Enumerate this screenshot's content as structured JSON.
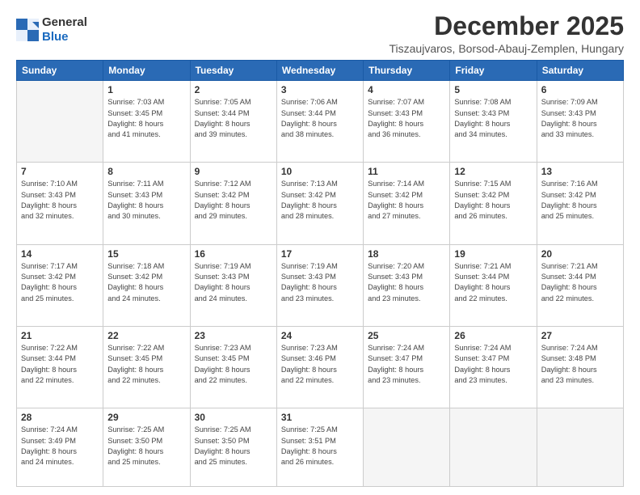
{
  "logo": {
    "general": "General",
    "blue": "Blue"
  },
  "title": "December 2025",
  "location": "Tiszaujvaros, Borsod-Abauj-Zemplen, Hungary",
  "weekdays": [
    "Sunday",
    "Monday",
    "Tuesday",
    "Wednesday",
    "Thursday",
    "Friday",
    "Saturday"
  ],
  "weeks": [
    [
      {
        "day": null,
        "sunrise": null,
        "sunset": null,
        "daylight": null
      },
      {
        "day": "1",
        "sunrise": "7:03 AM",
        "sunset": "3:45 PM",
        "daylight": "8 hours and 41 minutes."
      },
      {
        "day": "2",
        "sunrise": "7:05 AM",
        "sunset": "3:44 PM",
        "daylight": "8 hours and 39 minutes."
      },
      {
        "day": "3",
        "sunrise": "7:06 AM",
        "sunset": "3:44 PM",
        "daylight": "8 hours and 38 minutes."
      },
      {
        "day": "4",
        "sunrise": "7:07 AM",
        "sunset": "3:43 PM",
        "daylight": "8 hours and 36 minutes."
      },
      {
        "day": "5",
        "sunrise": "7:08 AM",
        "sunset": "3:43 PM",
        "daylight": "8 hours and 34 minutes."
      },
      {
        "day": "6",
        "sunrise": "7:09 AM",
        "sunset": "3:43 PM",
        "daylight": "8 hours and 33 minutes."
      }
    ],
    [
      {
        "day": "7",
        "sunrise": "7:10 AM",
        "sunset": "3:43 PM",
        "daylight": "8 hours and 32 minutes."
      },
      {
        "day": "8",
        "sunrise": "7:11 AM",
        "sunset": "3:43 PM",
        "daylight": "8 hours and 30 minutes."
      },
      {
        "day": "9",
        "sunrise": "7:12 AM",
        "sunset": "3:42 PM",
        "daylight": "8 hours and 29 minutes."
      },
      {
        "day": "10",
        "sunrise": "7:13 AM",
        "sunset": "3:42 PM",
        "daylight": "8 hours and 28 minutes."
      },
      {
        "day": "11",
        "sunrise": "7:14 AM",
        "sunset": "3:42 PM",
        "daylight": "8 hours and 27 minutes."
      },
      {
        "day": "12",
        "sunrise": "7:15 AM",
        "sunset": "3:42 PM",
        "daylight": "8 hours and 26 minutes."
      },
      {
        "day": "13",
        "sunrise": "7:16 AM",
        "sunset": "3:42 PM",
        "daylight": "8 hours and 25 minutes."
      }
    ],
    [
      {
        "day": "14",
        "sunrise": "7:17 AM",
        "sunset": "3:42 PM",
        "daylight": "8 hours and 25 minutes."
      },
      {
        "day": "15",
        "sunrise": "7:18 AM",
        "sunset": "3:42 PM",
        "daylight": "8 hours and 24 minutes."
      },
      {
        "day": "16",
        "sunrise": "7:19 AM",
        "sunset": "3:43 PM",
        "daylight": "8 hours and 24 minutes."
      },
      {
        "day": "17",
        "sunrise": "7:19 AM",
        "sunset": "3:43 PM",
        "daylight": "8 hours and 23 minutes."
      },
      {
        "day": "18",
        "sunrise": "7:20 AM",
        "sunset": "3:43 PM",
        "daylight": "8 hours and 23 minutes."
      },
      {
        "day": "19",
        "sunrise": "7:21 AM",
        "sunset": "3:44 PM",
        "daylight": "8 hours and 22 minutes."
      },
      {
        "day": "20",
        "sunrise": "7:21 AM",
        "sunset": "3:44 PM",
        "daylight": "8 hours and 22 minutes."
      }
    ],
    [
      {
        "day": "21",
        "sunrise": "7:22 AM",
        "sunset": "3:44 PM",
        "daylight": "8 hours and 22 minutes."
      },
      {
        "day": "22",
        "sunrise": "7:22 AM",
        "sunset": "3:45 PM",
        "daylight": "8 hours and 22 minutes."
      },
      {
        "day": "23",
        "sunrise": "7:23 AM",
        "sunset": "3:45 PM",
        "daylight": "8 hours and 22 minutes."
      },
      {
        "day": "24",
        "sunrise": "7:23 AM",
        "sunset": "3:46 PM",
        "daylight": "8 hours and 22 minutes."
      },
      {
        "day": "25",
        "sunrise": "7:24 AM",
        "sunset": "3:47 PM",
        "daylight": "8 hours and 23 minutes."
      },
      {
        "day": "26",
        "sunrise": "7:24 AM",
        "sunset": "3:47 PM",
        "daylight": "8 hours and 23 minutes."
      },
      {
        "day": "27",
        "sunrise": "7:24 AM",
        "sunset": "3:48 PM",
        "daylight": "8 hours and 23 minutes."
      }
    ],
    [
      {
        "day": "28",
        "sunrise": "7:24 AM",
        "sunset": "3:49 PM",
        "daylight": "8 hours and 24 minutes."
      },
      {
        "day": "29",
        "sunrise": "7:25 AM",
        "sunset": "3:50 PM",
        "daylight": "8 hours and 25 minutes."
      },
      {
        "day": "30",
        "sunrise": "7:25 AM",
        "sunset": "3:50 PM",
        "daylight": "8 hours and 25 minutes."
      },
      {
        "day": "31",
        "sunrise": "7:25 AM",
        "sunset": "3:51 PM",
        "daylight": "8 hours and 26 minutes."
      },
      {
        "day": null,
        "sunrise": null,
        "sunset": null,
        "daylight": null
      },
      {
        "day": null,
        "sunrise": null,
        "sunset": null,
        "daylight": null
      },
      {
        "day": null,
        "sunrise": null,
        "sunset": null,
        "daylight": null
      }
    ]
  ]
}
